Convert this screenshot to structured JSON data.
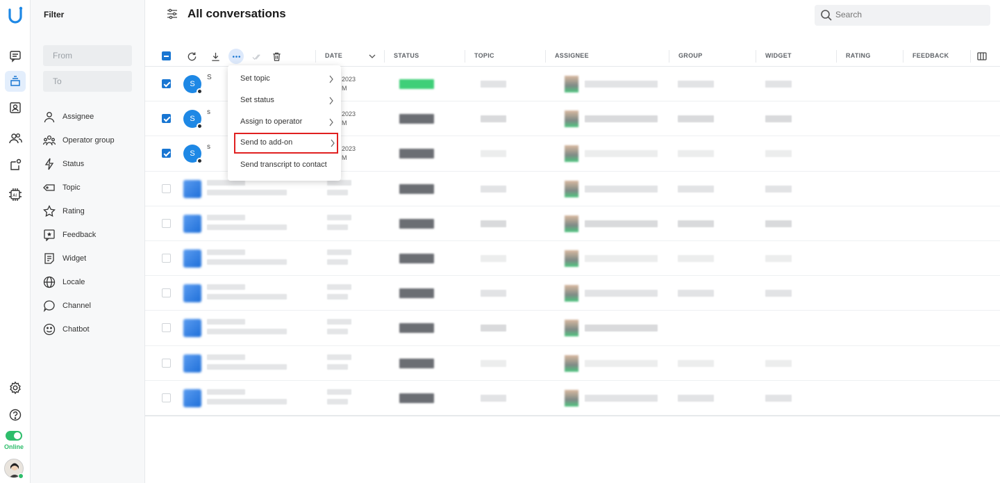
{
  "app": {
    "title": "All conversations"
  },
  "filter": {
    "heading": "Filter",
    "from_placeholder": "From",
    "to_placeholder": "To",
    "items": [
      {
        "label": "Assignee",
        "icon": "person-icon"
      },
      {
        "label": "Operator group",
        "icon": "group-icon"
      },
      {
        "label": "Status",
        "icon": "bolt-icon"
      },
      {
        "label": "Topic",
        "icon": "tag-icon"
      },
      {
        "label": "Rating",
        "icon": "star-icon"
      },
      {
        "label": "Feedback",
        "icon": "feedback-icon"
      },
      {
        "label": "Widget",
        "icon": "widget-icon"
      },
      {
        "label": "Locale",
        "icon": "globe-icon"
      },
      {
        "label": "Channel",
        "icon": "chat-bubble-icon"
      },
      {
        "label": "Chatbot",
        "icon": "smiley-icon"
      }
    ]
  },
  "search": {
    "placeholder": "Search"
  },
  "columns": [
    "DATE",
    "STATUS",
    "TOPIC",
    "ASSIGNEE",
    "GROUP",
    "WIDGET",
    "RATING",
    "FEEDBACK"
  ],
  "status": {
    "online_label": "Online"
  },
  "context_menu": {
    "items": [
      {
        "label": "Set topic",
        "has_submenu": true
      },
      {
        "label": "Set status",
        "has_submenu": true
      },
      {
        "label": "Assign to operator",
        "has_submenu": true
      },
      {
        "label": "Send to add-on",
        "has_submenu": true,
        "highlighted": true
      },
      {
        "label": "Send transcript to contact",
        "has_submenu": false
      }
    ]
  },
  "rows": [
    {
      "checked": true,
      "avatar": "S",
      "name": "S",
      "date_frag": "2023",
      "time_frag": "M"
    },
    {
      "checked": true,
      "avatar": "S",
      "name": "s",
      "date_frag": "2023",
      "time_frag": "M"
    },
    {
      "checked": true,
      "avatar": "S",
      "name": "s",
      "date_frag": "2023",
      "time_frag": "M"
    },
    {
      "checked": false
    },
    {
      "checked": false
    },
    {
      "checked": false
    },
    {
      "checked": false
    },
    {
      "checked": false
    },
    {
      "checked": false
    },
    {
      "checked": false
    }
  ],
  "colors": {
    "accent": "#1976d2",
    "online": "#2ebd6b",
    "highlight": "#e02020"
  }
}
